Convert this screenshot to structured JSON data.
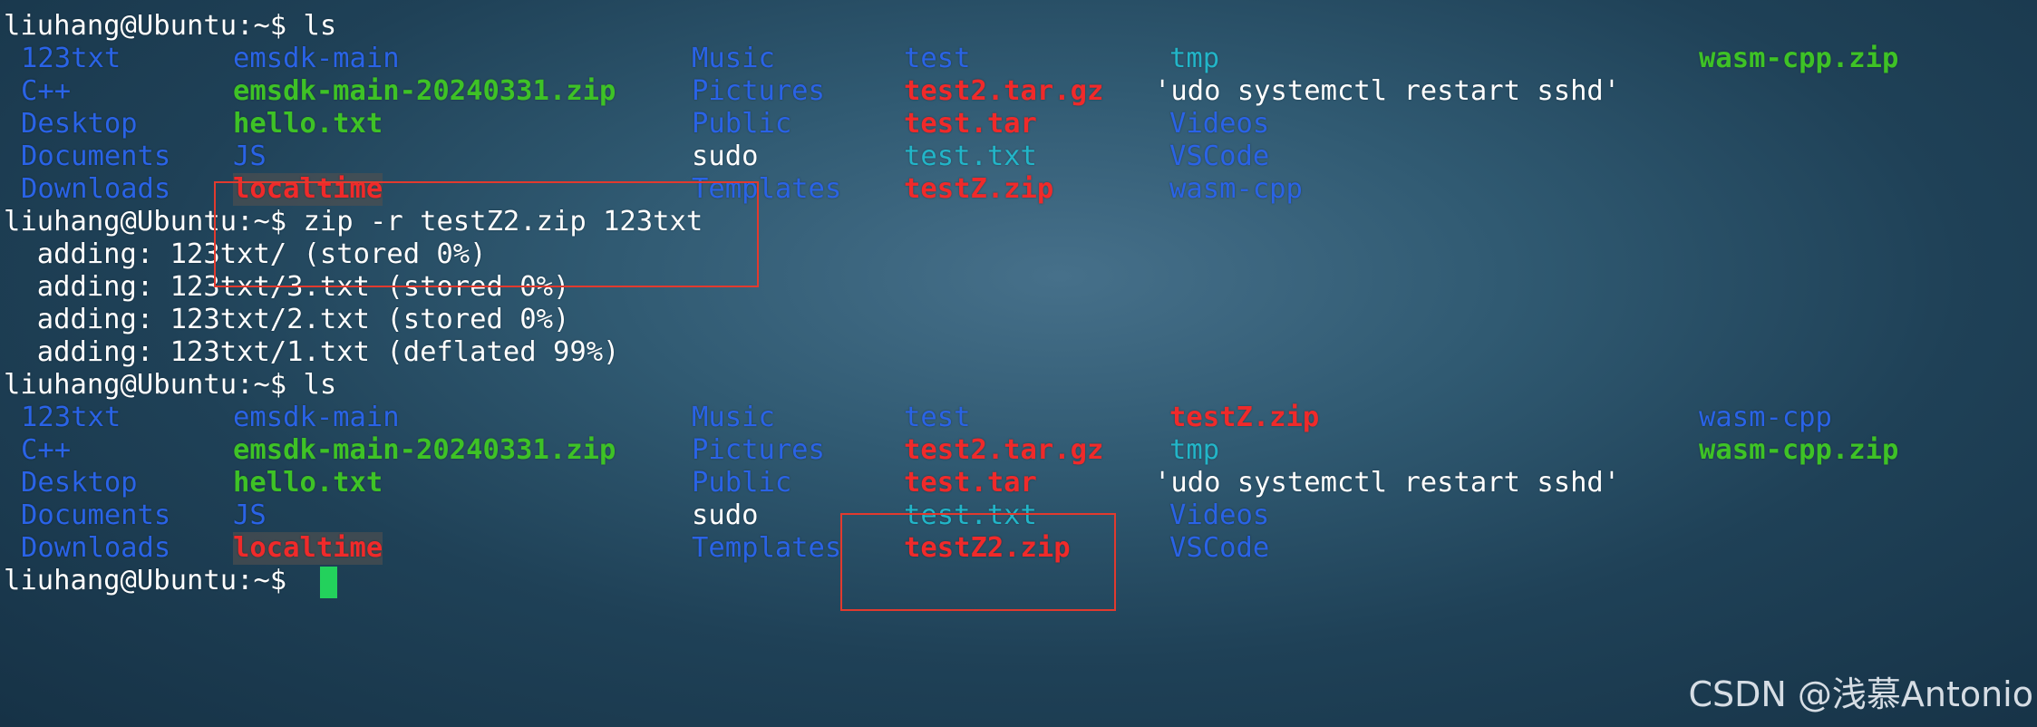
{
  "colors": {
    "directory": "#2a63e6",
    "executable": "#3ec226",
    "archive": "#f02a2a",
    "symlink": "#22b5c8",
    "plain": "#ffffff",
    "cursor": "#23d15c",
    "annotation": "#e23a2e"
  },
  "prompt": "liuhang@Ubuntu:~$",
  "session": {
    "cmd_ls_1": "ls",
    "listing_1": {
      "col1": [
        "123txt",
        "C++",
        "Desktop",
        "Documents",
        "Downloads"
      ],
      "col2": [
        "emsdk-main",
        "emsdk-main-20240331.zip",
        "hello.txt",
        "JS",
        "localtime"
      ],
      "col3": [
        "Music",
        "Pictures",
        "Public",
        "sudo",
        "Templates"
      ],
      "col4": [
        "test",
        "test2.tar.gz",
        "test.tar",
        "test.txt",
        "testZ.zip"
      ],
      "col5": [
        "tmp",
        "'udo systemctl restart sshd'",
        "Videos",
        "VSCode",
        "wasm-cpp"
      ],
      "col6": [
        "wasm-cpp.zip"
      ]
    },
    "cmd_zip": "zip -r testZ2.zip 123txt",
    "zip_output": [
      "  adding: 123txt/ (stored 0%)",
      "  adding: 123txt/3.txt (stored 0%)",
      "  adding: 123txt/2.txt (stored 0%)",
      "  adding: 123txt/1.txt (deflated 99%)"
    ],
    "cmd_ls_2": "ls",
    "listing_2": {
      "col1": [
        "123txt",
        "C++",
        "Desktop",
        "Documents",
        "Downloads"
      ],
      "col2": [
        "emsdk-main",
        "emsdk-main-20240331.zip",
        "hello.txt",
        "JS",
        "localtime"
      ],
      "col3": [
        "Music",
        "Pictures",
        "Public",
        "sudo",
        "Templates"
      ],
      "col4": [
        "test",
        "test2.tar.gz",
        "test.tar",
        "test.txt",
        "testZ2.zip"
      ],
      "col5": [
        "testZ.zip",
        "tmp",
        "'udo systemctl restart sshd'",
        "Videos",
        "VSCode"
      ],
      "col6": [
        "wasm-cpp",
        "wasm-cpp.zip"
      ]
    }
  },
  "watermark": "CSDN @浅慕Antonio"
}
